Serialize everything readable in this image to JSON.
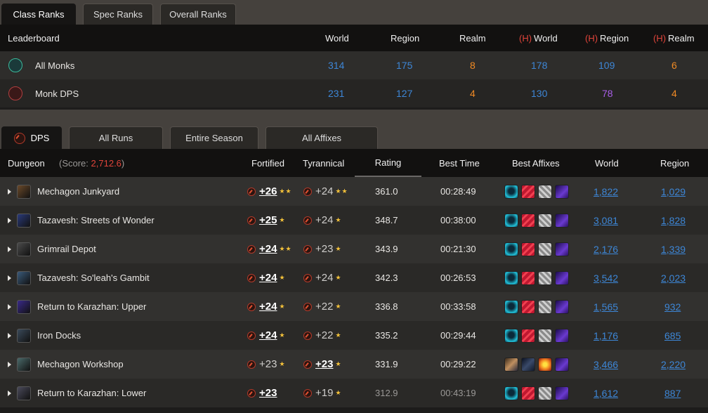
{
  "top_tabs": [
    {
      "label": "Class Ranks",
      "active": true
    },
    {
      "label": "Spec Ranks",
      "active": false
    },
    {
      "label": "Overall Ranks",
      "active": false
    }
  ],
  "leaderboard": {
    "header": {
      "name": "Leaderboard",
      "world": "World",
      "region": "Region",
      "realm": "Realm",
      "h_prefix": "(H)",
      "h_world": "World",
      "h_region": "Region",
      "h_realm": "Realm"
    },
    "rows": [
      {
        "name": "All Monks",
        "world": "314",
        "region": "175",
        "realm": "8",
        "h_world": "178",
        "h_region": "109",
        "h_realm": "6"
      },
      {
        "name": "Monk DPS",
        "world": "231",
        "region": "127",
        "realm": "4",
        "h_world": "130",
        "h_region": "78",
        "h_realm": "4"
      }
    ]
  },
  "run_tabs": [
    {
      "label": "DPS",
      "active": true
    },
    {
      "label": "All Runs",
      "active": false
    },
    {
      "label": "Entire Season",
      "active": false
    },
    {
      "label": "All Affixes",
      "active": false
    }
  ],
  "dungeons": {
    "header": {
      "dungeon": "Dungeon",
      "score_prefix": "(Score:",
      "score": "2,712.6",
      "score_suffix": ")",
      "fortified": "Fortified",
      "tyrannical": "Tyrannical",
      "rating": "Rating",
      "best_time": "Best Time",
      "best_affixes": "Best Affixes",
      "world": "World",
      "region": "Region"
    },
    "rows": [
      {
        "name": "Mechagon Junkyard",
        "fort": "+26",
        "fort_stars": "★★",
        "tyr": "+24",
        "tyr_stars": "★★",
        "best": "fort",
        "rating": "361.0",
        "time": "00:28:49",
        "affixes": [
          "tyr",
          "bolster",
          "storm",
          "encrypt"
        ],
        "world": "1,822",
        "region": "1,029"
      },
      {
        "name": "Tazavesh: Streets of Wonder",
        "fort": "+25",
        "fort_stars": "★",
        "tyr": "+24",
        "tyr_stars": "★",
        "best": "fort",
        "rating": "348.7",
        "time": "00:38:00",
        "affixes": [
          "tyr",
          "bolster",
          "storm",
          "encrypt"
        ],
        "world": "3,081",
        "region": "1,828"
      },
      {
        "name": "Grimrail Depot",
        "fort": "+24",
        "fort_stars": "★★",
        "tyr": "+23",
        "tyr_stars": "★",
        "best": "fort",
        "rating": "343.9",
        "time": "00:21:30",
        "affixes": [
          "tyr",
          "bolster",
          "storm",
          "encrypt"
        ],
        "world": "2,176",
        "region": "1,339"
      },
      {
        "name": "Tazavesh: So'leah's Gambit",
        "fort": "+24",
        "fort_stars": "★",
        "tyr": "+24",
        "tyr_stars": "★",
        "best": "fort",
        "rating": "342.3",
        "time": "00:26:53",
        "affixes": [
          "tyr",
          "bolster",
          "storm",
          "encrypt"
        ],
        "world": "3,542",
        "region": "2,023"
      },
      {
        "name": "Return to Karazhan: Upper",
        "fort": "+24",
        "fort_stars": "★",
        "tyr": "+22",
        "tyr_stars": "★",
        "best": "fort",
        "rating": "336.8",
        "time": "00:33:58",
        "affixes": [
          "tyr",
          "bolster",
          "storm",
          "encrypt"
        ],
        "world": "1,565",
        "region": "932"
      },
      {
        "name": "Iron Docks",
        "fort": "+24",
        "fort_stars": "★",
        "tyr": "+22",
        "tyr_stars": "★",
        "best": "fort",
        "rating": "335.2",
        "time": "00:29:44",
        "affixes": [
          "tyr",
          "bolster",
          "storm",
          "encrypt"
        ],
        "world": "1,176",
        "region": "685"
      },
      {
        "name": "Mechagon Workshop",
        "fort": "+23",
        "fort_stars": "★",
        "tyr": "+23",
        "tyr_stars": "★",
        "best": "tyr",
        "rating": "331.9",
        "time": "00:29:22",
        "affixes": [
          "fort",
          "sanguine",
          "explode",
          "encrypt"
        ],
        "world": "3,466",
        "region": "2,220"
      },
      {
        "name": "Return to Karazhan: Lower",
        "fort": "+23",
        "fort_stars": "",
        "tyr": "+19",
        "tyr_stars": "★",
        "best": "fort",
        "rating": "312.9",
        "time": "00:43:19",
        "affixes": [
          "tyr",
          "bolster",
          "storm",
          "encrypt"
        ],
        "world": "1,612",
        "region": "887",
        "dim": true
      }
    ]
  },
  "colors": {
    "blue": "#3d86d6",
    "orange": "#f08a24",
    "purple": "#a95ee8",
    "red": "#e0443a",
    "star": "#f3c13a"
  }
}
